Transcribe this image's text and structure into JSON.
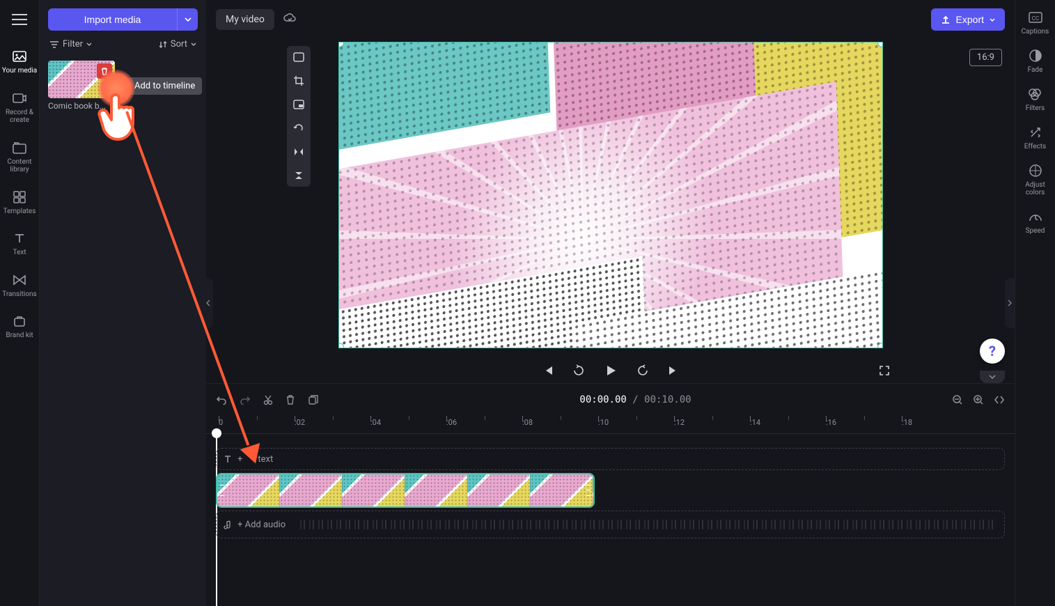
{
  "leftbar": {
    "items": [
      {
        "label": "Your media",
        "icon": "media"
      },
      {
        "label": "Record & create",
        "icon": "record"
      },
      {
        "label": "Content library",
        "icon": "library"
      },
      {
        "label": "Templates",
        "icon": "templates"
      },
      {
        "label": "Text",
        "icon": "text"
      },
      {
        "label": "Transitions",
        "icon": "transitions"
      },
      {
        "label": "Brand kit",
        "icon": "brand"
      }
    ]
  },
  "media_panel": {
    "import_label": "Import media",
    "filter_label": "Filter",
    "sort_label": "Sort",
    "asset_name": "Comic book b...",
    "tooltip": "Add to timeline"
  },
  "topbar": {
    "title": "My video",
    "export_label": "Export",
    "aspect_ratio": "16:9"
  },
  "rightbar": {
    "items": [
      {
        "label": "Captions",
        "icon": "captions"
      },
      {
        "label": "Fade",
        "icon": "fade"
      },
      {
        "label": "Filters",
        "icon": "filters"
      },
      {
        "label": "Effects",
        "icon": "effects"
      },
      {
        "label": "Adjust colors",
        "icon": "adjust"
      },
      {
        "label": "Speed",
        "icon": "speed"
      }
    ]
  },
  "timeline": {
    "current_time": "00:00.00",
    "total_time": "00:10.00",
    "ruler_start": 0,
    "ruler_labels": [
      "0",
      ":02",
      ":04",
      ":06",
      ":08",
      ":10",
      ":12",
      ":14",
      ":16",
      ":18"
    ],
    "text_track_label": "text",
    "audio_track_label": "+ Add audio"
  },
  "help": {
    "symbol": "?"
  }
}
